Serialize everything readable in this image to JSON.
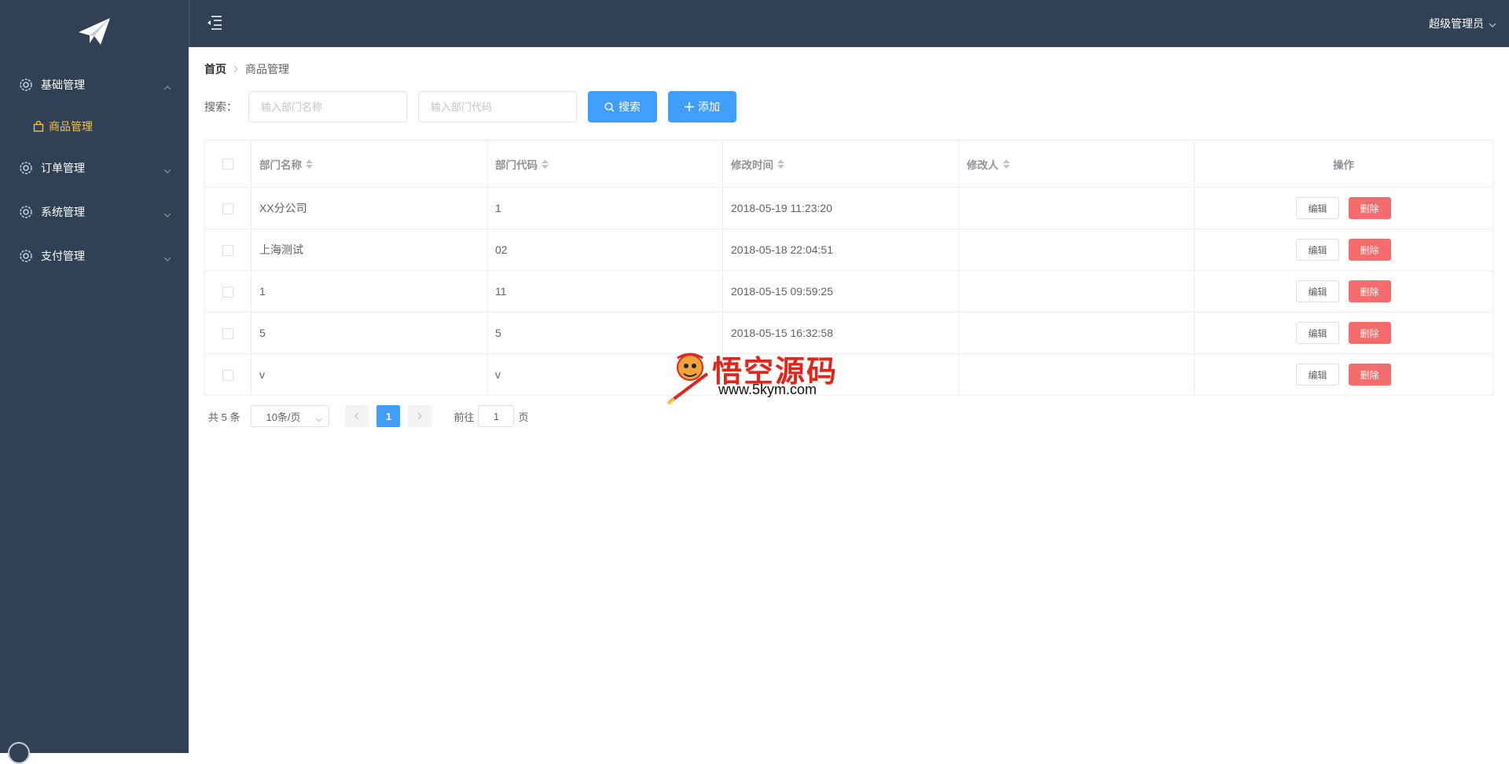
{
  "sidebar": {
    "menu": [
      {
        "label": "基础管理",
        "expanded": true,
        "children": [
          {
            "label": "商品管理",
            "active": true
          }
        ]
      },
      {
        "label": "订单管理",
        "expanded": false
      },
      {
        "label": "系统管理",
        "expanded": false
      },
      {
        "label": "支付管理",
        "expanded": false
      }
    ]
  },
  "header": {
    "user": "超级管理员"
  },
  "breadcrumb": {
    "home": "首页",
    "current": "商品管理"
  },
  "search": {
    "label": "搜索：",
    "name_placeholder": "输入部门名称",
    "code_placeholder": "输入部门代码",
    "search_button": "搜索",
    "add_button": "添加"
  },
  "table": {
    "columns": [
      "部门名称",
      "部门代码",
      "修改时间",
      "修改人",
      "操作"
    ],
    "rows": [
      {
        "name": "XX分公司",
        "code": "1",
        "time": "2018-05-19 11:23:20",
        "user": ""
      },
      {
        "name": "上海测试",
        "code": "02",
        "time": "2018-05-18 22:04:51",
        "user": ""
      },
      {
        "name": "1",
        "code": "11",
        "time": "2018-05-15 09:59:25",
        "user": ""
      },
      {
        "name": "5",
        "code": "5",
        "time": "2018-05-15 16:32:58",
        "user": ""
      },
      {
        "name": "v",
        "code": "v",
        "time": "",
        "user": ""
      }
    ],
    "edit_label": "编辑",
    "delete_label": "删除"
  },
  "pagination": {
    "total": "共 5 条",
    "page_size": "10条/页",
    "current_page": "1",
    "goto_label": "前往",
    "goto_value": "1",
    "page_suffix": "页"
  },
  "watermark": {
    "title": "悟空源码",
    "url": "www.5kym.com"
  },
  "colors": {
    "sidebar_bg": "#304156",
    "active_menu": "#f4c242",
    "primary": "#409eff",
    "danger": "#f56c6c"
  }
}
